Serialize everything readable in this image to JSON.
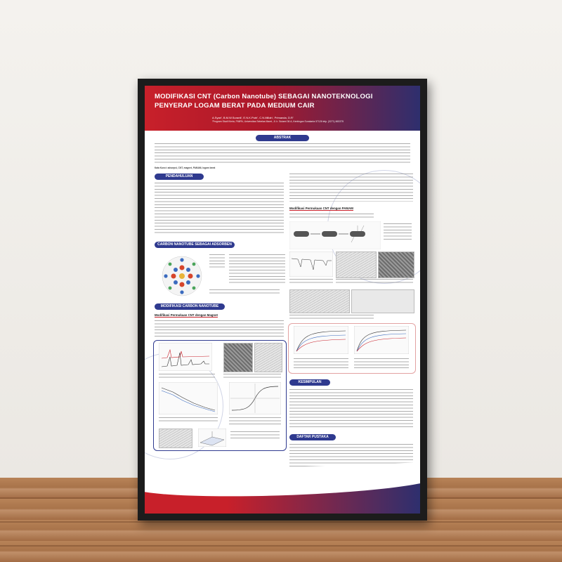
{
  "poster": {
    "title_line1": "MODIFIKASI CNT (Carbon Nanotube) SEBAGAI NANOTEKNOLOGI",
    "title_line2": "PENYERAP LOGAM BERAT PADA MEDIUM CAIR",
    "authors": "A.Syari', B.M.W.Suranti', E.N.K.Putri', C.N.Millah', Primanda, D.R'",
    "affiliation": "'Program Studi Kimia, FMIPA, Universitas Sebelas Maret, Jl. Ir. Sutami 36 A, Kentingan Surakarta 57126 telp. (0271) 663375",
    "sections": {
      "abstrak": "ABSTRAK",
      "pendahuluan": "PENDAHULUAN",
      "cnt_adsorben": "CARBON NANOTUBE SEBAGAI ADSORBEN",
      "modifikasi_cnt": "MODIFIKASI CARBON NANOTUBE",
      "kesimpulan": "KESIMPULAN",
      "daftar_pustaka": "DAFTAR PUSTAKA"
    },
    "subsections": {
      "cnt_magnet": "Modifikasi Permukaan CNT dengan Magnet",
      "cnt_pamam": "Modifikasi Permukaan CNT dengan PAMAM"
    },
    "keywords": "Kata Kunci: adsorpsi, CNT, magnet, PAMAM, logam berat"
  },
  "colors": {
    "header_red": "#c8202a",
    "header_navy": "#2e2f6e",
    "section_blue": "#2f3a8f",
    "frame": "#1c1c1c",
    "floor_wood": "#a8734a"
  }
}
